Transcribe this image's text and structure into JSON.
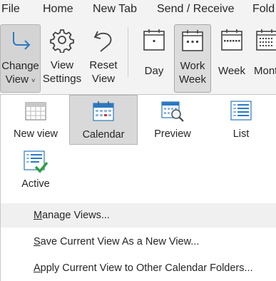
{
  "menu": {
    "tabs": [
      "File",
      "Home",
      "New Tab",
      "Send / Receive",
      "Fold"
    ]
  },
  "ribbon": {
    "change_view": {
      "line1": "Change",
      "line2": "View",
      "chevron": "˅"
    },
    "view_settings": {
      "line1": "View",
      "line2": "Settings"
    },
    "reset_view": {
      "line1": "Reset",
      "line2": "View"
    },
    "day": {
      "label": "Day"
    },
    "work_week": {
      "line1": "Work",
      "line2": "Week"
    },
    "week": {
      "label": "Week"
    },
    "month": {
      "label": "Mont"
    }
  },
  "views": {
    "new_view": "New view",
    "calendar": "Calendar",
    "preview": "Preview",
    "list": "List",
    "active": "Active"
  },
  "menu_items": {
    "manage_views": {
      "first": "M",
      "rest": "anage Views..."
    },
    "save_view": {
      "first": "S",
      "rest": "ave Current View As a New View..."
    },
    "apply_view": {
      "first": "A",
      "rest": "pply Current View to Other Calendar Folders..."
    }
  },
  "colors": {
    "accent_blue": "#2b79c2",
    "calendar_red": "#d13438",
    "check_green": "#2ea043",
    "selected_bg": "#d9d9d9"
  }
}
